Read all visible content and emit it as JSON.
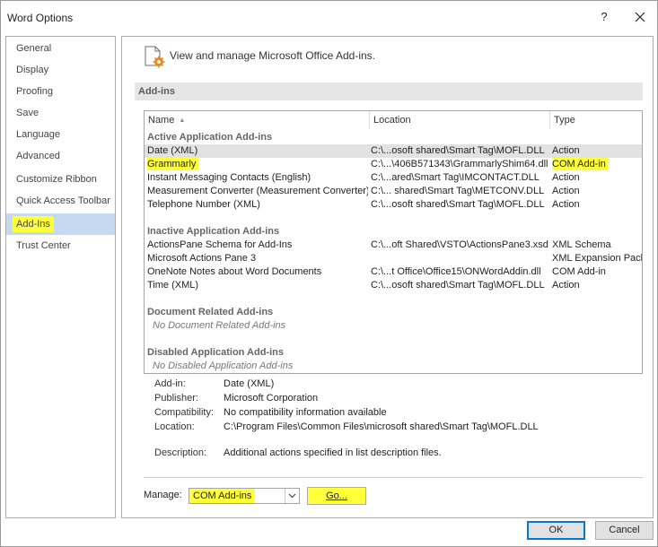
{
  "window": {
    "title": "Word Options",
    "help_glyph": "?",
    "close_icon": "close-icon"
  },
  "nav": {
    "items": [
      {
        "label": "General"
      },
      {
        "label": "Display"
      },
      {
        "label": "Proofing"
      },
      {
        "label": "Save"
      },
      {
        "label": "Language"
      },
      {
        "label": "Advanced"
      },
      {
        "label": "Customize Ribbon"
      },
      {
        "label": "Quick Access Toolbar"
      },
      {
        "label": "Add-Ins",
        "selected": true
      },
      {
        "label": "Trust Center"
      }
    ]
  },
  "header": {
    "icon": "addins-gear-icon",
    "text": "View and manage Microsoft Office Add-ins."
  },
  "section": {
    "title": "Add-ins"
  },
  "list": {
    "columns": {
      "name": "Name",
      "sort_glyph": "▲",
      "location": "Location",
      "type": "Type"
    },
    "groups": [
      {
        "title": "Active Application Add-ins",
        "rows": [
          {
            "name": "Date (XML)",
            "location": "C:\\...osoft shared\\Smart Tag\\MOFL.DLL",
            "type": "Action"
          },
          {
            "name": "Grammarly",
            "location": "C:\\...\\406B571343\\GrammarlyShim64.dll",
            "type": "COM Add-in"
          },
          {
            "name": "Instant Messaging Contacts (English)",
            "location": "C:\\...ared\\Smart Tag\\IMCONTACT.DLL",
            "type": "Action"
          },
          {
            "name": "Measurement Converter (Measurement Converter)",
            "location": "C:\\... shared\\Smart Tag\\METCONV.DLL",
            "type": "Action"
          },
          {
            "name": "Telephone Number (XML)",
            "location": "C:\\...osoft shared\\Smart Tag\\MOFL.DLL",
            "type": "Action"
          }
        ]
      },
      {
        "title": "Inactive Application Add-ins",
        "rows": [
          {
            "name": "ActionsPane Schema for Add-Ins",
            "location": "C:\\...oft Shared\\VSTO\\ActionsPane3.xsd",
            "type": "XML Schema"
          },
          {
            "name": "Microsoft Actions Pane 3",
            "location": "",
            "type": "XML Expansion Pack"
          },
          {
            "name": "OneNote Notes about Word Documents",
            "location": "C:\\...t Office\\Office15\\ONWordAddin.dll",
            "type": "COM Add-in"
          },
          {
            "name": "Time (XML)",
            "location": "C:\\...osoft shared\\Smart Tag\\MOFL.DLL",
            "type": "Action"
          }
        ]
      },
      {
        "title": "Document Related Add-ins",
        "empty": "No Document Related Add-ins"
      },
      {
        "title": "Disabled Application Add-ins",
        "empty": "No Disabled Application Add-ins"
      }
    ]
  },
  "details": {
    "addin_label": "Add-in:",
    "addin_value": "Date (XML)",
    "publisher_label": "Publisher:",
    "publisher_value": "Microsoft Corporation",
    "compat_label": "Compatibility:",
    "compat_value": "No compatibility information available",
    "location_label": "Location:",
    "location_value": "C:\\Program Files\\Common Files\\microsoft shared\\Smart Tag\\MOFL.DLL",
    "desc_label": "Description:",
    "desc_value": "Additional actions specified in list description files."
  },
  "manage": {
    "label": "Manage:",
    "selected": "COM Add-ins",
    "go_label": "Go..."
  },
  "footer": {
    "ok_label": "OK",
    "cancel_label": "Cancel"
  },
  "colors": {
    "highlight": "#ffff3a",
    "nav_selected": "#c5d9f1",
    "default_button_border": "#0078d7",
    "section_bar": "#e6e6e6"
  }
}
